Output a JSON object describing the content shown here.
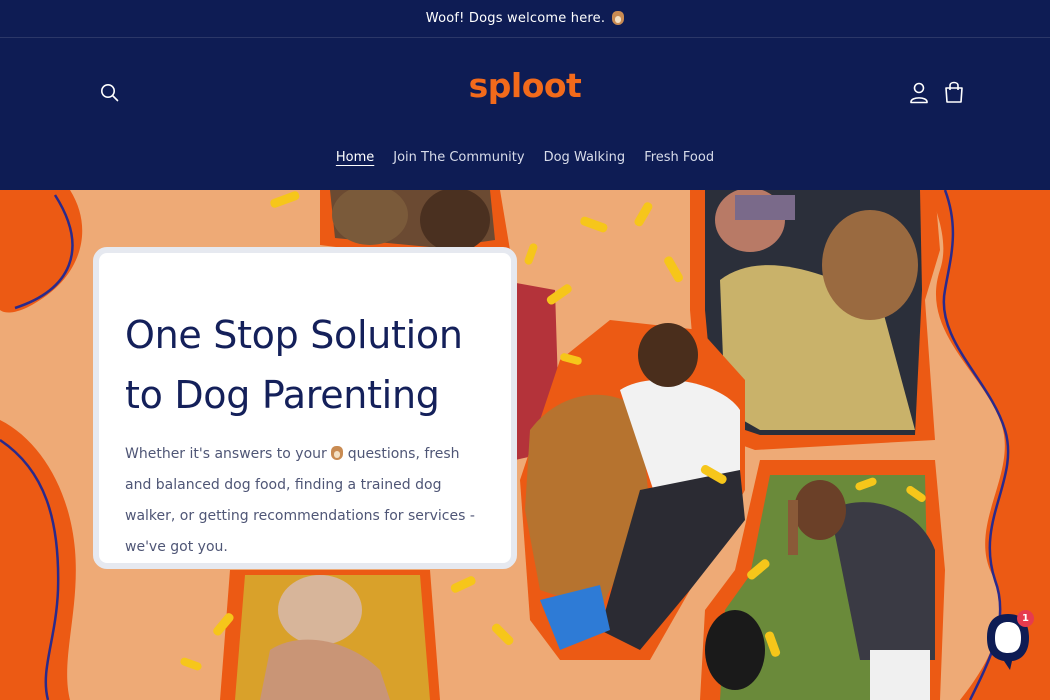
{
  "announcement": {
    "text": "Woof! Dogs welcome here.",
    "icon": "dog-face-icon"
  },
  "header": {
    "logo": "sploot",
    "search_icon": "search-icon",
    "account_icon": "account-icon",
    "cart_icon": "shopping-bag-icon"
  },
  "nav": {
    "items": [
      {
        "label": "Home",
        "active": true
      },
      {
        "label": "Join The Community",
        "active": false
      },
      {
        "label": "Dog Walking",
        "active": false
      },
      {
        "label": "Fresh Food",
        "active": false
      }
    ]
  },
  "hero": {
    "title": "One Stop Solution to Dog Parenting",
    "text_before_icon": "Whether it's answers to your",
    "text_after_icon": "questions, fresh and balanced dog food, finding a trained dog walker, or getting recommendations for services - we've got you.",
    "inline_icon": "dog-face-icon"
  },
  "chat": {
    "badge_count": "1",
    "icon": "chat-bubble-icon"
  },
  "colors": {
    "navy": "#0e1c54",
    "brand_orange": "#f26a1b",
    "hero_peach": "#e8a36e",
    "badge_red": "#e63b4e"
  }
}
